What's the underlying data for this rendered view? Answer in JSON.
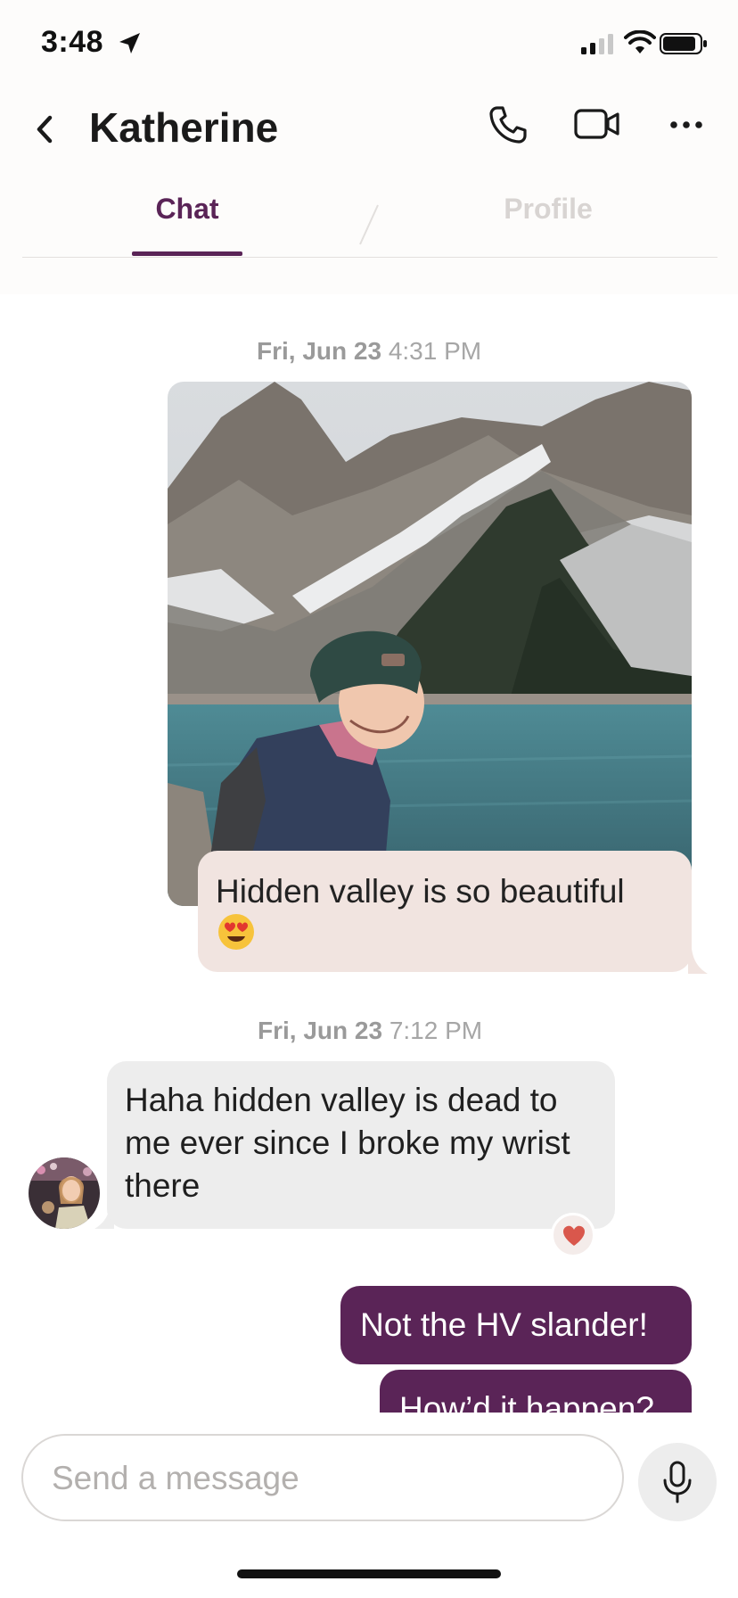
{
  "status_bar": {
    "time": "3:48"
  },
  "header": {
    "contact_name": "Katherine"
  },
  "tabs": [
    {
      "label": "Chat",
      "active": true
    },
    {
      "label": "Profile",
      "active": false
    }
  ],
  "messages": [
    {
      "timestamp_date": "Fri, Jun 23",
      "timestamp_time": "4:31 PM"
    },
    {
      "direction": "outgoing",
      "type": "photo",
      "caption": "Hidden valley is so beautiful",
      "emoji": "heart-eyes"
    },
    {
      "timestamp_date": "Fri, Jun 23",
      "timestamp_time": "7:12 PM"
    },
    {
      "direction": "incoming",
      "text": "Haha hidden valley is dead to me ever since I broke my wrist there",
      "reaction": "heart"
    },
    {
      "direction": "outgoing",
      "text": "Not the HV slander!"
    },
    {
      "direction": "outgoing",
      "text": "How’d it happen?"
    }
  ],
  "composer": {
    "placeholder": "Send a message"
  },
  "colors": {
    "accent": "#5a2457",
    "incoming_bubble": "#ededed",
    "photo_caption_bubble": "#f1e4e0",
    "reaction": "#d9574c"
  }
}
